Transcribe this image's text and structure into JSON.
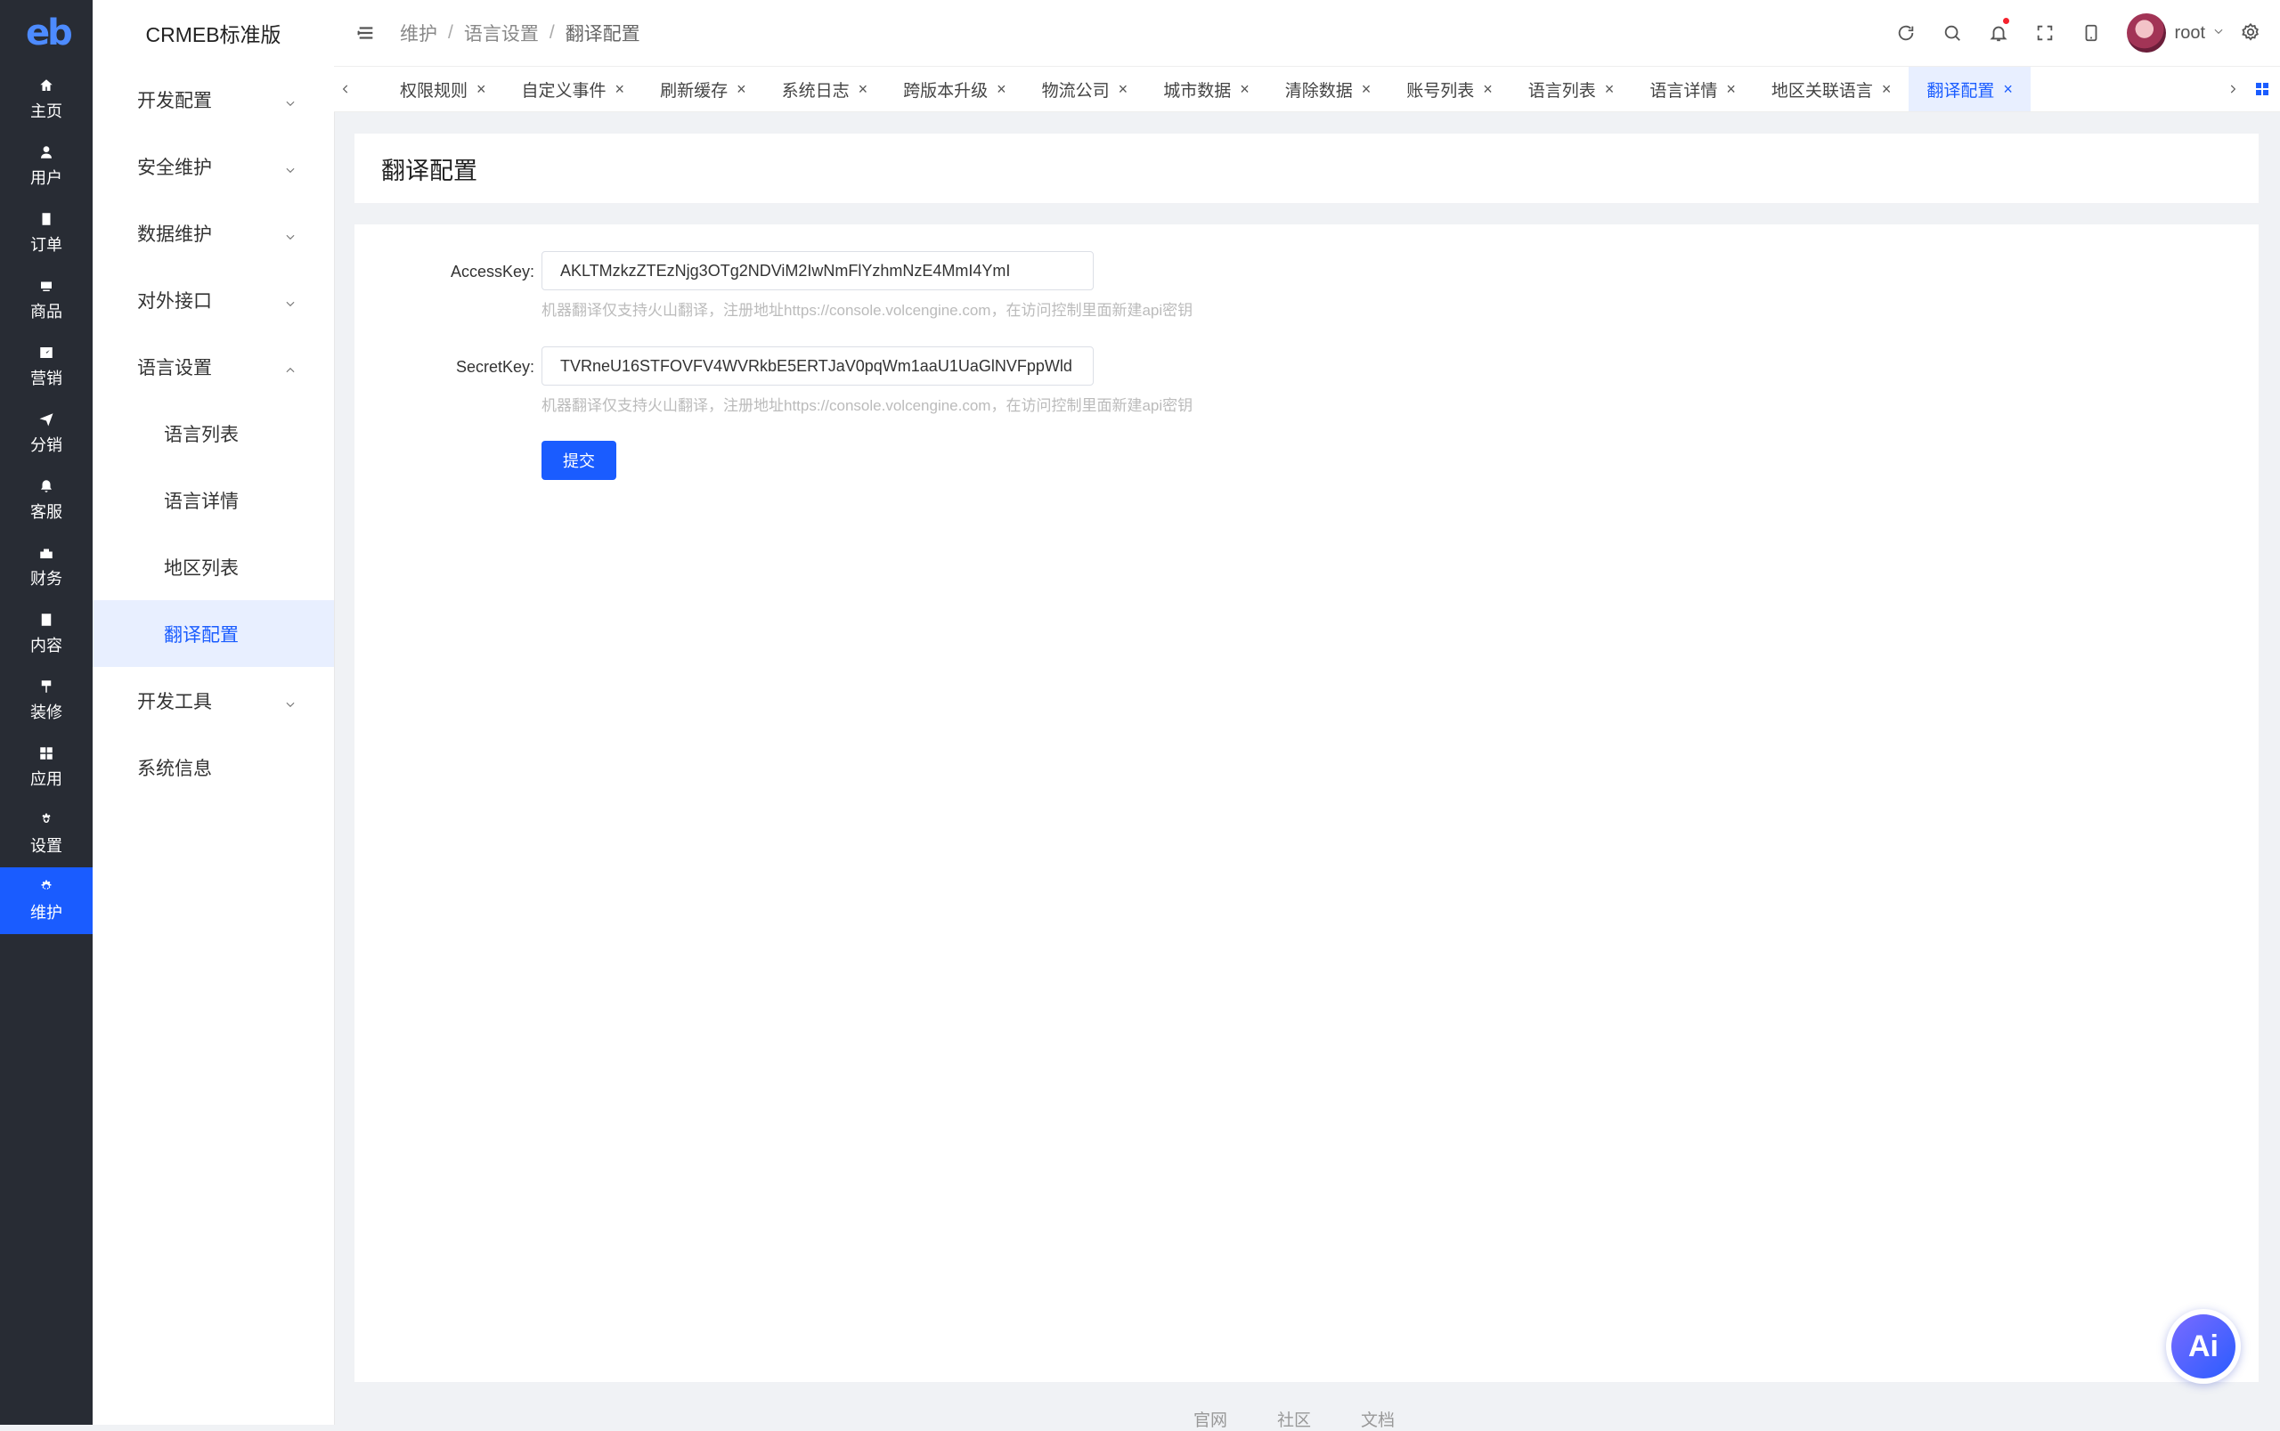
{
  "rail": {
    "logo": "eb",
    "items": [
      {
        "label": "主页",
        "icon": "home-icon"
      },
      {
        "label": "用户",
        "icon": "user-icon"
      },
      {
        "label": "订单",
        "icon": "order-icon"
      },
      {
        "label": "商品",
        "icon": "product-icon"
      },
      {
        "label": "营销",
        "icon": "marketing-icon"
      },
      {
        "label": "分销",
        "icon": "distribution-icon"
      },
      {
        "label": "客服",
        "icon": "service-icon"
      },
      {
        "label": "财务",
        "icon": "finance-icon"
      },
      {
        "label": "内容",
        "icon": "content-icon"
      },
      {
        "label": "装修",
        "icon": "decorate-icon"
      },
      {
        "label": "应用",
        "icon": "apps-icon"
      },
      {
        "label": "设置",
        "icon": "settings-icon"
      },
      {
        "label": "维护",
        "icon": "maintenance-icon",
        "active": true
      }
    ]
  },
  "submenu": {
    "brand": "CRMEB标准版",
    "items": [
      {
        "label": "开发配置"
      },
      {
        "label": "安全维护"
      },
      {
        "label": "数据维护"
      },
      {
        "label": "对外接口"
      },
      {
        "label": "语言设置",
        "expanded": true
      },
      {
        "label": "语言列表"
      },
      {
        "label": "语言详情"
      },
      {
        "label": "地区列表"
      },
      {
        "label": "翻译配置",
        "active": true
      },
      {
        "label": "开发工具"
      },
      {
        "label": "系统信息"
      }
    ]
  },
  "header": {
    "breadcrumb": [
      "维护",
      "语言设置",
      "翻译配置"
    ],
    "breadcrumb_sep": "/",
    "username": "root"
  },
  "tabs": [
    {
      "label": "权限规则"
    },
    {
      "label": "自定义事件"
    },
    {
      "label": "刷新缓存"
    },
    {
      "label": "系统日志"
    },
    {
      "label": "跨版本升级"
    },
    {
      "label": "物流公司"
    },
    {
      "label": "城市数据"
    },
    {
      "label": "清除数据"
    },
    {
      "label": "账号列表"
    },
    {
      "label": "语言列表"
    },
    {
      "label": "语言详情"
    },
    {
      "label": "地区关联语言"
    },
    {
      "label": "翻译配置",
      "active": true
    }
  ],
  "page": {
    "title": "翻译配置",
    "access_key_label": "AccessKey:",
    "access_key_value": "AKLTMzkzZTEzNjg3OTg2NDViM2IwNmFlYzhmNzE4MmI4YmI",
    "access_key_hint": "机器翻译仅支持火山翻译，注册地址https://console.volcengine.com，在访问控制里面新建api密钥",
    "secret_key_label": "SecretKey:",
    "secret_key_value": "TVRneU16STFOVFV4WVRkbE5ERTJaV0pqWm1aaU1UaGlNVFppWld",
    "secret_key_hint": "机器翻译仅支持火山翻译，注册地址https://console.volcengine.com，在访问控制里面新建api密钥",
    "submit_label": "提交"
  },
  "footer": [
    "官网",
    "社区",
    "文档"
  ],
  "ai_button": "Ai",
  "colors": {
    "accent": "#1a5cff",
    "rail_bg": "#282c34",
    "active_bg": "#e8efff"
  }
}
